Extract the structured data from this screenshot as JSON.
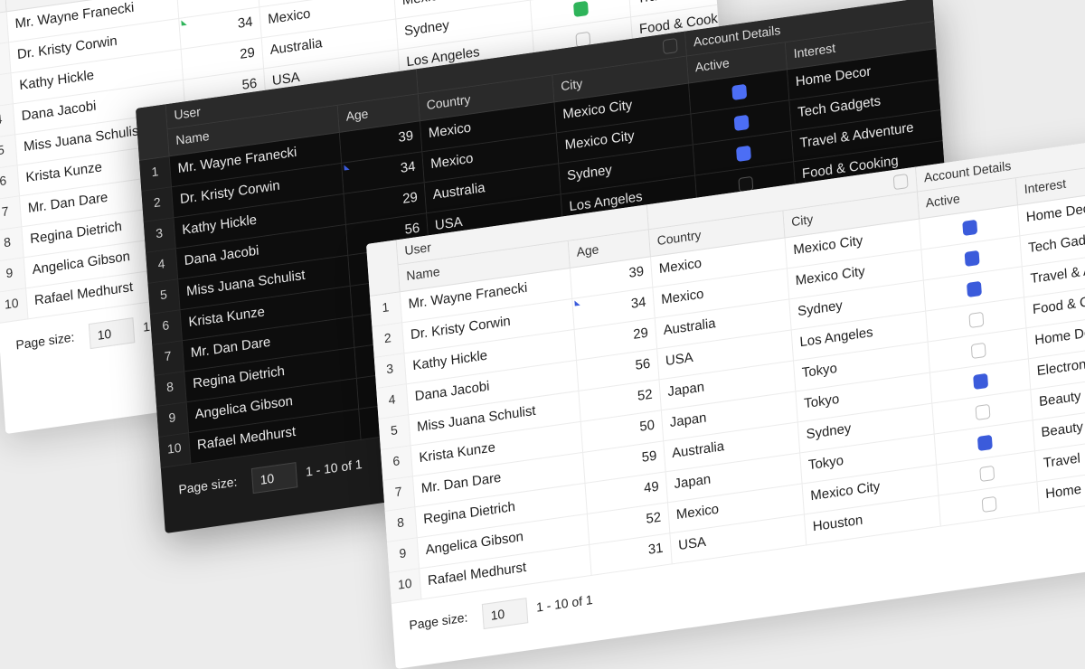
{
  "grid": {
    "group_user": "User",
    "group_account": "Account Details",
    "columns": {
      "name": "Name",
      "age": "Age",
      "country": "Country",
      "city": "City",
      "active": "Active",
      "interest": "Interest"
    },
    "rows": [
      {
        "index": "1",
        "name": "Mr. Wayne Franecki",
        "age": "39",
        "country": "Mexico",
        "city": "Mexico City",
        "active": true,
        "interest": "Home Decor"
      },
      {
        "index": "2",
        "name": "Dr. Kristy Corwin",
        "age": "34",
        "country": "Mexico",
        "city": "Mexico City",
        "active": true,
        "interest": "Tech Gadgets"
      },
      {
        "index": "3",
        "name": "Kathy Hickle",
        "age": "29",
        "country": "Australia",
        "city": "Sydney",
        "active": true,
        "interest": "Travel & Adventure"
      },
      {
        "index": "4",
        "name": "Dana Jacobi",
        "age": "56",
        "country": "USA",
        "city": "Los Angeles",
        "active": false,
        "interest": "Food & Cooking"
      },
      {
        "index": "5",
        "name": "Miss Juana Schulist",
        "age": "52",
        "country": "Japan",
        "city": "Tokyo",
        "active": false,
        "interest": "Home Decor"
      },
      {
        "index": "6",
        "name": "Krista Kunze",
        "age": "50",
        "country": "Japan",
        "city": "Tokyo",
        "active": true,
        "interest": "Electronics"
      },
      {
        "index": "7",
        "name": "Mr. Dan Dare",
        "age": "59",
        "country": "Australia",
        "city": "Sydney",
        "active": false,
        "interest": "Beauty"
      },
      {
        "index": "8",
        "name": "Regina Dietrich",
        "age": "49",
        "country": "Japan",
        "city": "Tokyo",
        "active": true,
        "interest": "Beauty"
      },
      {
        "index": "9",
        "name": "Angelica Gibson",
        "age": "52",
        "country": "Mexico",
        "city": "Mexico City",
        "active": false,
        "interest": "Travel"
      },
      {
        "index": "10",
        "name": "Rafael Medhurst",
        "age": "31",
        "country": "USA",
        "city": "Houston",
        "active": false,
        "interest": "Home Decor"
      }
    ],
    "page_size_label": "Page size:",
    "page_size_value": "10",
    "pager_text": "1 - 10 of 1"
  },
  "colors": {
    "accent_blue": "#3b5bdb",
    "accent_blue_dark_theme": "#4c6ef5",
    "accent_green": "#2fb45a",
    "sort_marker_green": "#2fb45a",
    "sort_marker_blue": "#3b5bdb"
  },
  "themes": [
    {
      "name": "light-back",
      "accent": "#2fb45a"
    },
    {
      "name": "dark",
      "accent": "#4c6ef5"
    },
    {
      "name": "light-front",
      "accent": "#3b5bdb"
    }
  ]
}
